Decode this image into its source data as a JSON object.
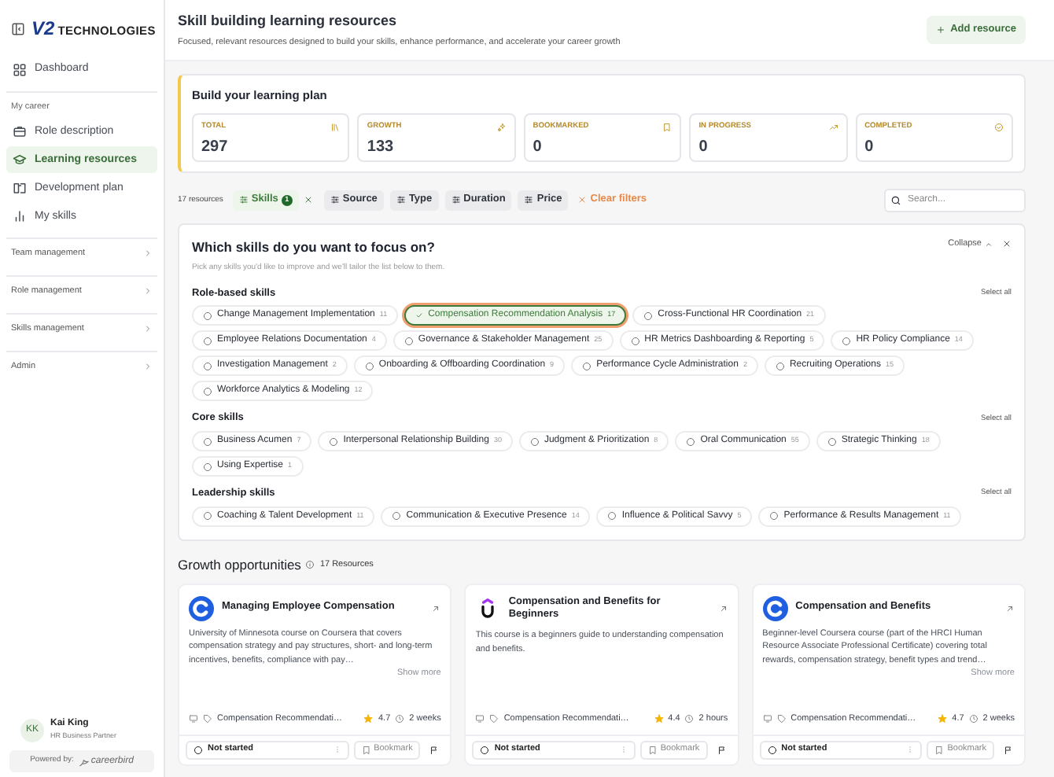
{
  "sidebar": {
    "logo": {
      "mark": "V2",
      "name": "TECHNOLOGIES"
    },
    "top_items": [
      {
        "label": "Dashboard",
        "kind": "grid",
        "selected": false
      }
    ],
    "section": {
      "title": "My career",
      "items": [
        {
          "label": "Role description",
          "kind": "briefcase",
          "selected": false
        },
        {
          "label": "Learning resources",
          "kind": "cap",
          "selected": true
        },
        {
          "label": "Development plan",
          "kind": "book",
          "selected": false
        },
        {
          "label": "My skills",
          "kind": "bars",
          "selected": false
        }
      ]
    },
    "groups": [
      {
        "label": "Team management",
        "expanded": false
      },
      {
        "label": "Role management",
        "expanded": false
      },
      {
        "label": "Skills management",
        "expanded": false
      },
      {
        "label": "Admin",
        "expanded": false
      }
    ],
    "user": {
      "initials": "KK",
      "name": "Kai King",
      "role": "HR Business Partner"
    },
    "powered_by": {
      "label": "Powered by:",
      "brand": "careerbird"
    }
  },
  "header": {
    "title": "Skill building learning resources",
    "subtitle": "Focused, relevant resources designed to build your skills, enhance performance, and accelerate your career growth",
    "add_button": "Add resource"
  },
  "plan": {
    "title": "Build your learning plan",
    "stats": [
      {
        "label": "TOTAL",
        "value": "297",
        "kind": "library"
      },
      {
        "label": "GROWTH",
        "value": "133",
        "kind": "sparkle"
      },
      {
        "label": "BOOKMARKED",
        "value": "0",
        "kind": "bookmark"
      },
      {
        "label": "IN PROGRESS",
        "value": "0",
        "kind": "trend"
      },
      {
        "label": "COMPLETED",
        "value": "0",
        "kind": "check"
      }
    ]
  },
  "filters": {
    "count": "17 resources",
    "chips": [
      {
        "label": "Skills",
        "active": true,
        "badge": "1"
      },
      {
        "label": "Source",
        "active": false
      },
      {
        "label": "Type",
        "active": false
      },
      {
        "label": "Duration",
        "active": false
      },
      {
        "label": "Price",
        "active": false
      }
    ],
    "clear": "Clear filters",
    "search": {
      "placeholder": "Search..."
    }
  },
  "skills_panel": {
    "title": "Which skills do you want to focus on?",
    "subtitle": "Pick any skills you'd like to improve and we'll tailor the list below to them.",
    "collapse": "Collapse",
    "groups": [
      {
        "title": "Role-based skills",
        "select_all": "Select all",
        "skills": [
          {
            "name": "Change Management Implementation",
            "count": "11",
            "selected": false
          },
          {
            "name": "Compensation Recommendation Analysis",
            "count": "17",
            "selected": true
          },
          {
            "name": "Cross-Functional HR Coordination",
            "count": "21",
            "selected": false
          },
          {
            "name": "Employee Relations Documentation",
            "count": "4",
            "selected": false
          },
          {
            "name": "Governance & Stakeholder Management",
            "count": "25",
            "selected": false
          },
          {
            "name": "HR Metrics Dashboarding & Reporting",
            "count": "5",
            "selected": false
          },
          {
            "name": "HR Policy Compliance",
            "count": "14",
            "selected": false
          },
          {
            "name": "Investigation Management",
            "count": "2",
            "selected": false
          },
          {
            "name": "Onboarding & Offboarding Coordination",
            "count": "9",
            "selected": false
          },
          {
            "name": "Performance Cycle Administration",
            "count": "2",
            "selected": false
          },
          {
            "name": "Recruiting Operations",
            "count": "15",
            "selected": false
          },
          {
            "name": "Workforce Analytics & Modeling",
            "count": "12",
            "selected": false
          }
        ]
      },
      {
        "title": "Core skills",
        "select_all": "Select all",
        "skills": [
          {
            "name": "Business Acumen",
            "count": "7",
            "selected": false
          },
          {
            "name": "Interpersonal Relationship Building",
            "count": "30",
            "selected": false
          },
          {
            "name": "Judgment & Prioritization",
            "count": "8",
            "selected": false
          },
          {
            "name": "Oral Communication",
            "count": "55",
            "selected": false
          },
          {
            "name": "Strategic Thinking",
            "count": "18",
            "selected": false
          },
          {
            "name": "Using Expertise",
            "count": "1",
            "selected": false
          }
        ]
      },
      {
        "title": "Leadership skills",
        "select_all": "Select all",
        "skills": [
          {
            "name": "Coaching & Talent Development",
            "count": "11",
            "selected": false
          },
          {
            "name": "Communication & Executive Presence",
            "count": "14",
            "selected": false
          },
          {
            "name": "Influence & Political Savvy",
            "count": "5",
            "selected": false
          },
          {
            "name": "Performance & Results Management",
            "count": "11",
            "selected": false
          }
        ]
      }
    ]
  },
  "growth": {
    "title": "Growth opportunities",
    "count": "17 Resources",
    "cards": [
      {
        "kind": "ring",
        "title": "Managing Employee Compensation",
        "description": "University of Minnesota course on Coursera that covers compensation strategy and pay structures, short- and long-term incentives, benefits, compliance with pay…",
        "show_more": "Show more",
        "skill": "Compensation Recommendati…",
        "rating": "4.7",
        "duration": "2 weeks",
        "status": "Not started",
        "bookmark": "Bookmark"
      },
      {
        "kind": "cup",
        "title": "Compensation and Benefits for Beginners",
        "description": "This course is a beginners guide to understanding compensation and benefits.",
        "skill": "Compensation Recommendati…",
        "rating": "4.4",
        "duration": "2 hours",
        "status": "Not started",
        "bookmark": "Bookmark"
      },
      {
        "kind": "ring",
        "title": "Compensation and Benefits",
        "description": "Beginner-level Coursera course (part of the HRCI Human Resource Associate Professional Certificate) covering total rewards, compensation strategy, benefit types and trend…",
        "show_more": "Show more",
        "skill": "Compensation Recommendati…",
        "rating": "4.7",
        "duration": "2 weeks",
        "status": "Not started",
        "bookmark": "Bookmark"
      }
    ]
  }
}
